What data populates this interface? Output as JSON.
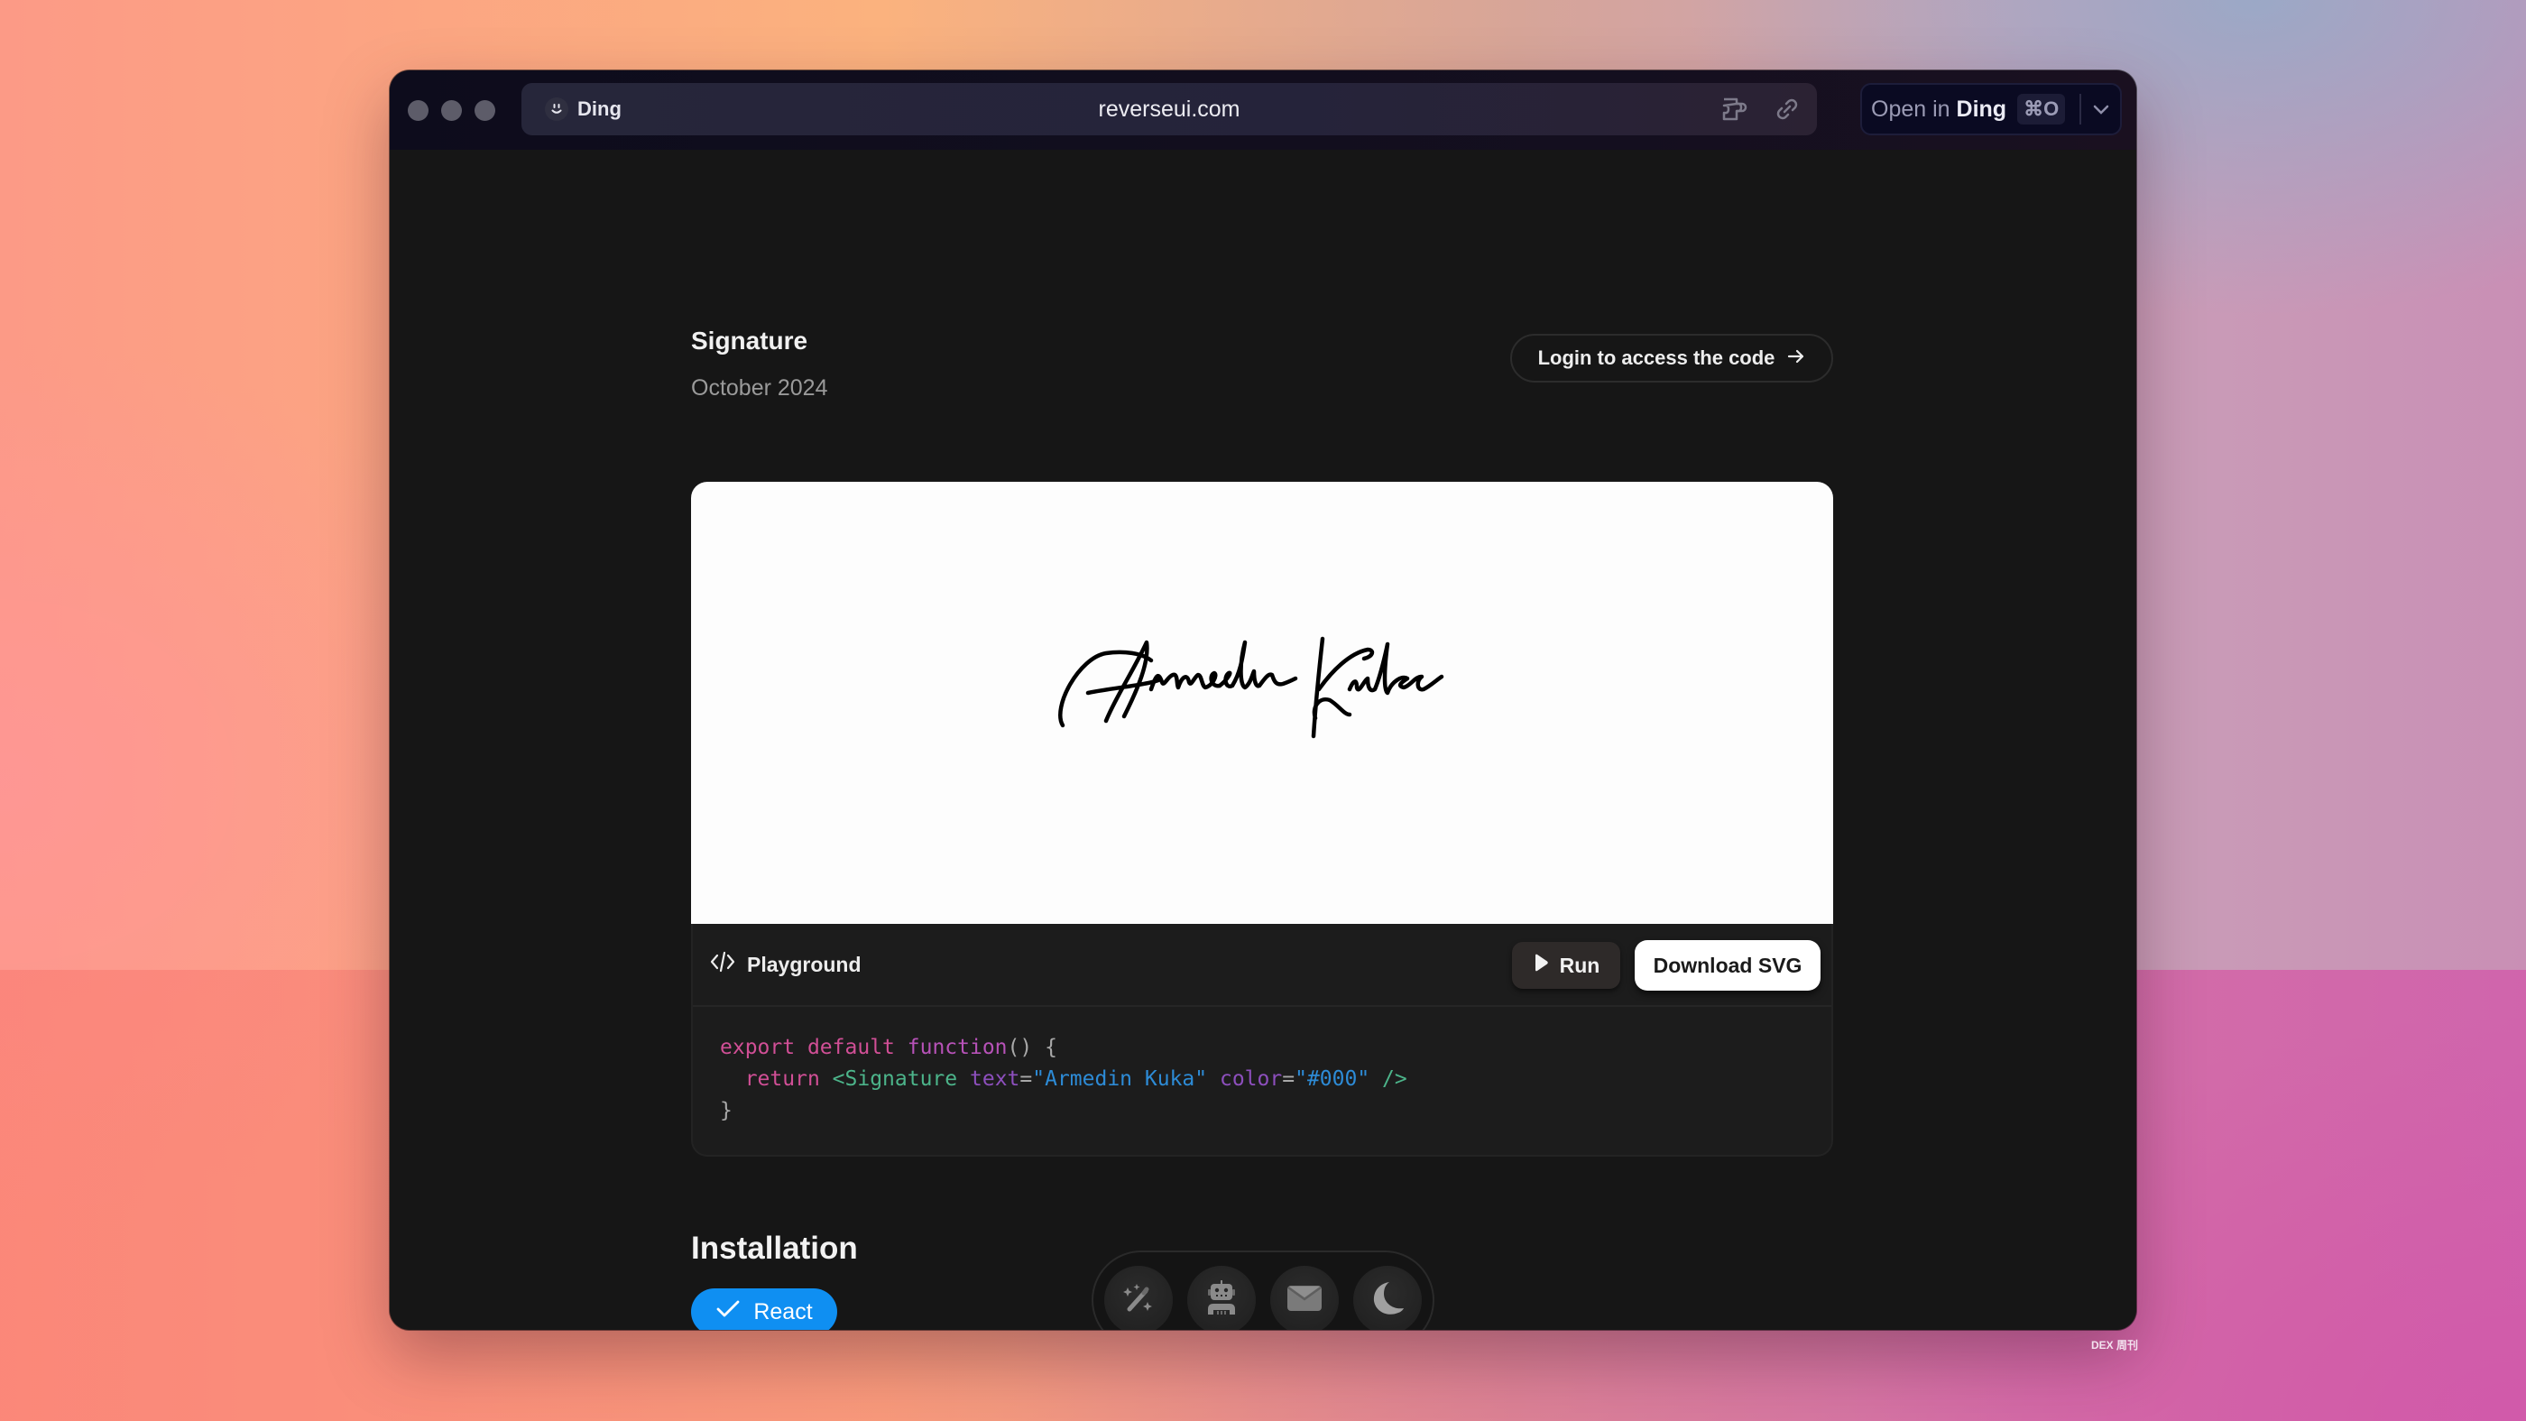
{
  "browser": {
    "app_name": "Ding",
    "url": "reverseui.com",
    "open_in_prefix": "Open in ",
    "open_in_app": "Ding",
    "shortcut": "⌘O",
    "icons": [
      "smiley-icon",
      "puzzle-icon",
      "link-icon",
      "chevron-down-icon"
    ]
  },
  "page": {
    "title": "Signature",
    "date": "October 2024",
    "login_button": "Login to access the code",
    "login_arrow": "→"
  },
  "preview": {
    "signature_text": "Armedin Kuka",
    "signature_color": "#000000",
    "background": "#fdfdfd"
  },
  "playground": {
    "label": "Playground",
    "run_label": "Run",
    "download_label": "Download SVG",
    "code": {
      "line1": {
        "kw1": "export",
        "kw2": "default",
        "kw3": "function",
        "rest": "() {"
      },
      "line2": {
        "indent": "  ",
        "kw": "return",
        "tag_open": "<Signature",
        "attr1": "text",
        "eq1": "=",
        "val1": "\"Armedin Kuka\"",
        "attr2": "color",
        "eq2": "=",
        "val2": "\"#000\"",
        "tag_close": "/>"
      },
      "line3": "}"
    }
  },
  "installation": {
    "title": "Installation",
    "selected_framework": "React",
    "accent": "#0f8ff2"
  },
  "dock": {
    "items": [
      {
        "name": "magic-wand-icon"
      },
      {
        "name": "robot-icon"
      },
      {
        "name": "mail-icon"
      },
      {
        "name": "moon-icon"
      }
    ]
  },
  "watermark": "DEX 周刊"
}
